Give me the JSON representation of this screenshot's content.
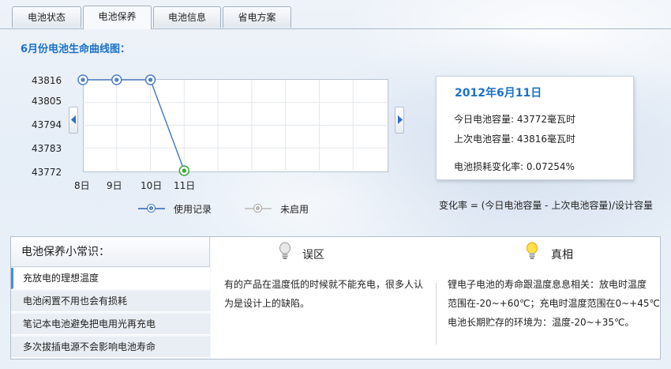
{
  "tabs": [
    "电池状态",
    "电池保养",
    "电池信息",
    "省电方案"
  ],
  "active_tab": 1,
  "chart": {
    "title": "6月份电池生命曲线图：",
    "y_ticks": [
      "43816",
      "43805",
      "43794",
      "43783",
      "43772"
    ],
    "x_ticks": [
      "8日",
      "9日",
      "10日",
      "11日"
    ],
    "legend": {
      "used": "使用记录",
      "unused": "未启用"
    },
    "colors": {
      "line": "#4a7fc1",
      "used_point": "#4f80c4",
      "last_point": "#3aa63a",
      "unused": "#9a9a9a"
    }
  },
  "chart_data": {
    "type": "line",
    "x": [
      "8日",
      "9日",
      "10日",
      "11日"
    ],
    "series": [
      {
        "name": "使用记录",
        "values": [
          43816,
          43816,
          43816,
          43772
        ]
      }
    ],
    "ylim": [
      43772,
      43816
    ],
    "grid": true
  },
  "card": {
    "date": "2012年6月11日",
    "today": "今日电池容量: 43772毫瓦时",
    "last": "上次电池容量: 43816毫瓦时",
    "rate": "电池损耗变化率: 0.07254%"
  },
  "formula": "变化率 = (今日电池容量 - 上次电池容量)/设计容量",
  "tips": {
    "title": "电池保养小常识：",
    "items": [
      "充放电的理想温度",
      "电池闲置不用也会有损耗",
      "笔记本电池避免把电用光再充电",
      "多次拔插电源不会影响电池寿命"
    ],
    "active": 0
  },
  "myth": {
    "title": "误区",
    "lines": [
      "有的产品在温度低的时候就不能充电，很多人认",
      "为是设计上的缺陷。"
    ]
  },
  "truth": {
    "title": "真相",
    "lines": [
      "锂电子电池的寿命跟温度息息相关：放电时温度",
      "范围在-20~+60℃；充电时温度范围在0~+45℃",
      "电池长期贮存的环境为：温度-20~+35℃。"
    ]
  }
}
